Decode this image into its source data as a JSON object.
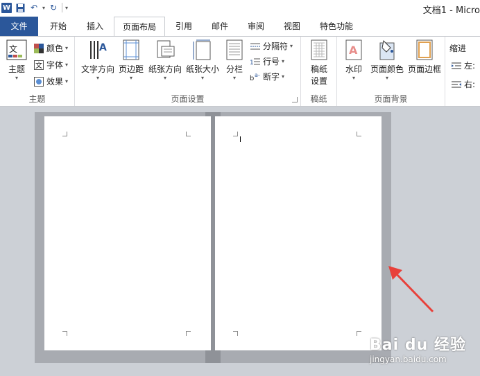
{
  "title": "文档1 - Micro",
  "tabs": [
    "文件",
    "开始",
    "插入",
    "页面布局",
    "引用",
    "邮件",
    "审阅",
    "视图",
    "特色功能"
  ],
  "ribbon": {
    "theme": {
      "group": "主题",
      "main": "主题",
      "colors": "颜色",
      "fonts": "字体",
      "effects": "效果"
    },
    "page_setup": {
      "group": "页面设置",
      "text_direction": "文字方向",
      "margins": "页边距",
      "orientation": "纸张方向",
      "size": "纸张大小",
      "columns": "分栏",
      "breaks": "分隔符",
      "line_numbers": "行号",
      "hyphenation": "断字"
    },
    "manuscript": {
      "group": "稿纸",
      "btn_line1": "稿纸",
      "btn_line2": "设置"
    },
    "page_background": {
      "group": "页面背景",
      "watermark": "水印",
      "page_color": "页面颜色",
      "page_borders": "页面边框"
    },
    "paragraph": {
      "indent": "缩进",
      "left": "左:",
      "right": "右:"
    }
  },
  "watermark": {
    "brand": "Bai du 经验",
    "url": "jingyan.baidu.com"
  },
  "colors": {
    "accent": "#2b579a",
    "arrow": "#e8403a"
  }
}
